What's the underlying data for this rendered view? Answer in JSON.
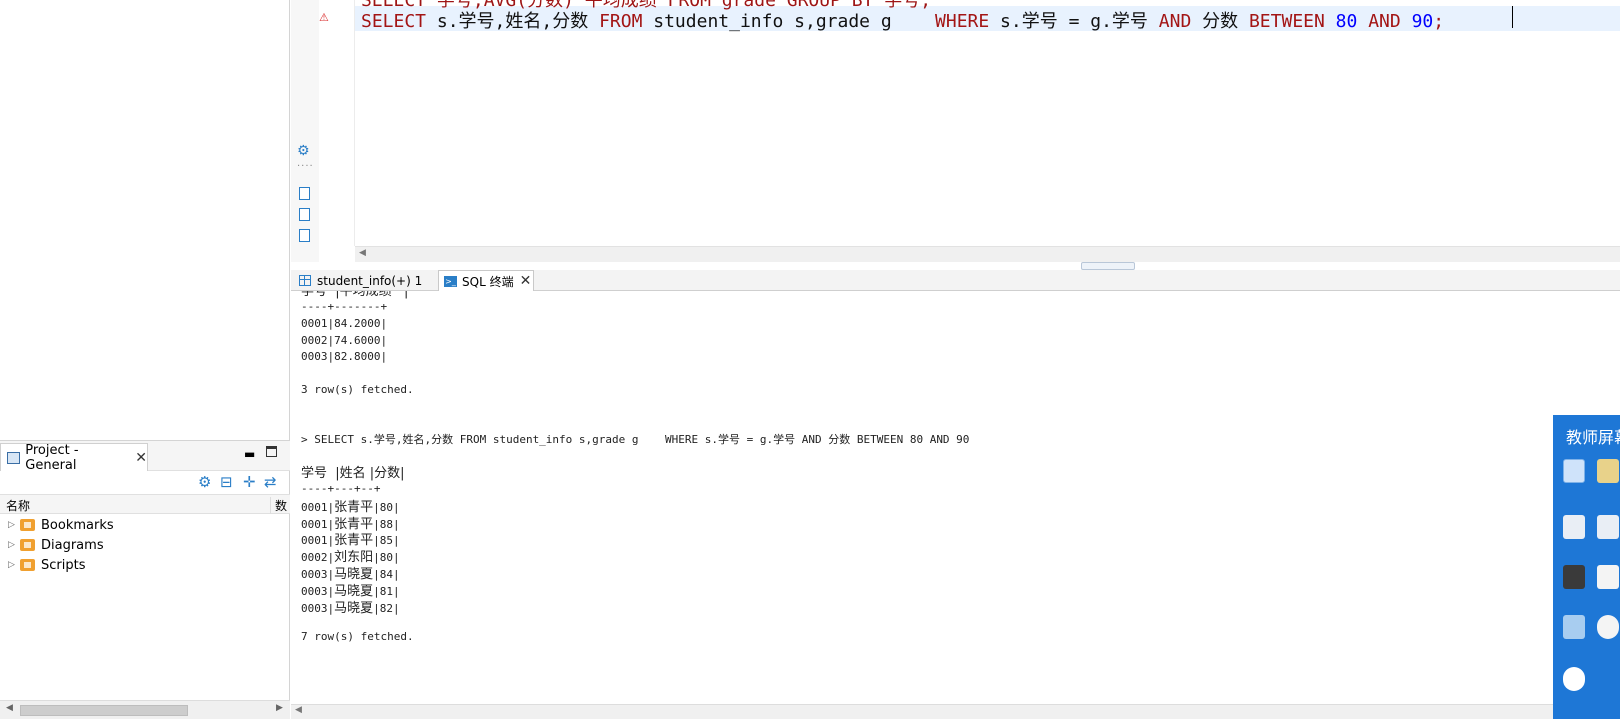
{
  "project_panel": {
    "title": "Project - General",
    "column_name": "名称",
    "column_data": "数",
    "items": [
      {
        "label": "Bookmarks"
      },
      {
        "label": "Diagrams"
      },
      {
        "label": "Scripts"
      }
    ]
  },
  "editor": {
    "prev_line_fragment": "SELECT 学号,AVG(分数) 平均成绩 FROM grade GROUP BY 学号;",
    "code": {
      "t1": "SELECT",
      "t2": " s.学号,姓名,分数 ",
      "t3": "FROM",
      "t4": " student_info s,grade g    ",
      "t5": "WHERE",
      "t6": " s.学号 = g.学号 ",
      "t7": "AND",
      "t8": " 分数 ",
      "t9": "BETWEEN",
      "t10": " ",
      "t11": "80",
      "t12": " ",
      "t13": "AND",
      "t14": " ",
      "t15": "90",
      "t16": ";"
    }
  },
  "tabs": {
    "result_tab": "student_info(+) 1",
    "sql_tab": "SQL 终端"
  },
  "console": {
    "header1": "学号  |平均成绩   |",
    "sep1": "----+-------+",
    "rows1": [
      "0001|84.2000|",
      "0002|74.6000|",
      "0003|82.8000|"
    ],
    "fetched1": "3 row(s) fetched.",
    "query2": "> SELECT s.学号,姓名,分数 FROM student_info s,grade g    WHERE s.学号 = g.学号 AND 分数 BETWEEN 80 AND 90",
    "header2": "学号  |姓名 |分数|",
    "sep2": "----+---+--+",
    "rows2": [
      {
        "id": "0001",
        "name": "张青平",
        "score": "80"
      },
      {
        "id": "0001",
        "name": "张青平",
        "score": "88"
      },
      {
        "id": "0001",
        "name": "张青平",
        "score": "85"
      },
      {
        "id": "0002",
        "name": "刘东阳",
        "score": "80"
      },
      {
        "id": "0003",
        "name": "马晓夏",
        "score": "84"
      },
      {
        "id": "0003",
        "name": "马晓夏",
        "score": "81"
      },
      {
        "id": "0003",
        "name": "马晓夏",
        "score": "82"
      }
    ],
    "fetched2": "7 row(s) fetched."
  },
  "overlay": {
    "title": "教师屏幕"
  },
  "colors": {
    "keyword": "#a31515",
    "number": "#0000ff",
    "accent": "#2a7ec7",
    "overlay_bg": "#1e77d6"
  }
}
